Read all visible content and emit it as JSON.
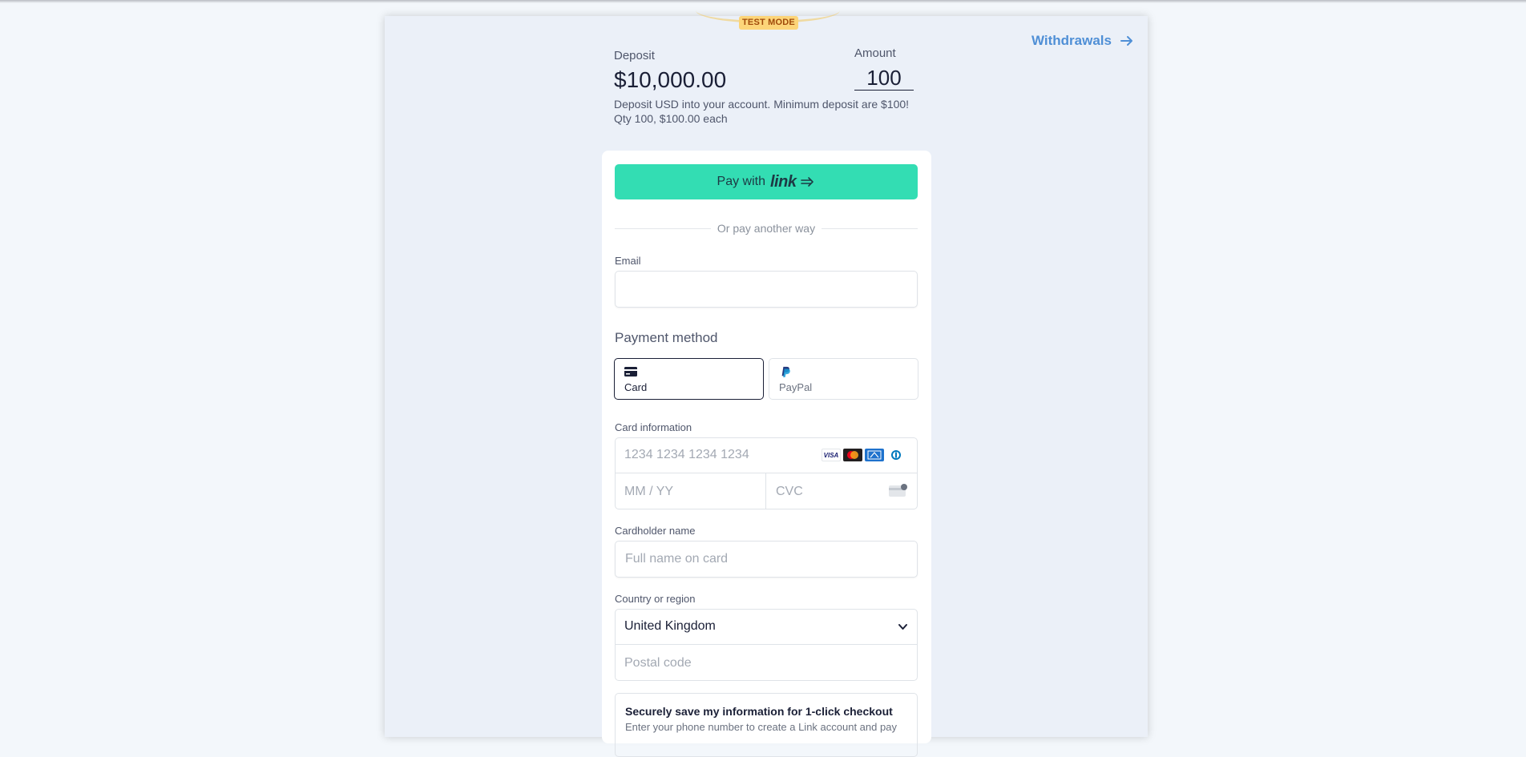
{
  "badge": {
    "test_mode": "TEST MODE"
  },
  "nav": {
    "withdrawals": "Withdrawals"
  },
  "product": {
    "name": "Deposit",
    "price": "$10,000.00",
    "description": "Deposit USD into your account. Minimum deposit are $100!",
    "qty_line": "Qty 100, $100.00 each"
  },
  "amount": {
    "label": "Amount",
    "value": "100"
  },
  "link_button": {
    "prefix": "Pay with",
    "brand": "link"
  },
  "divider": {
    "text": "Or pay another way"
  },
  "email": {
    "label": "Email",
    "value": "",
    "placeholder": ""
  },
  "payment_method": {
    "title": "Payment method",
    "options": [
      {
        "label": "Card",
        "icon": "card-icon",
        "selected": true
      },
      {
        "label": "PayPal",
        "icon": "paypal-icon",
        "selected": false
      }
    ]
  },
  "card_info": {
    "label": "Card information",
    "number_placeholder": "1234 1234 1234 1234",
    "expiry_placeholder": "MM / YY",
    "cvc_placeholder": "CVC",
    "brands": [
      "visa-icon",
      "mastercard-icon",
      "amex-icon",
      "diners-icon"
    ],
    "visa_text": "VISA"
  },
  "cardholder": {
    "label": "Cardholder name",
    "placeholder": "Full name on card"
  },
  "country": {
    "label": "Country or region",
    "selected": "United Kingdom",
    "postal_placeholder": "Postal code"
  },
  "save_info": {
    "title": "Securely save my information for 1-click checkout",
    "subtitle": "Enter your phone number to create a Link account and pay"
  },
  "colors": {
    "link_green": "#33ddb3",
    "accent_blue": "#4f8fd6",
    "test_mode_bg": "#fcd579"
  }
}
